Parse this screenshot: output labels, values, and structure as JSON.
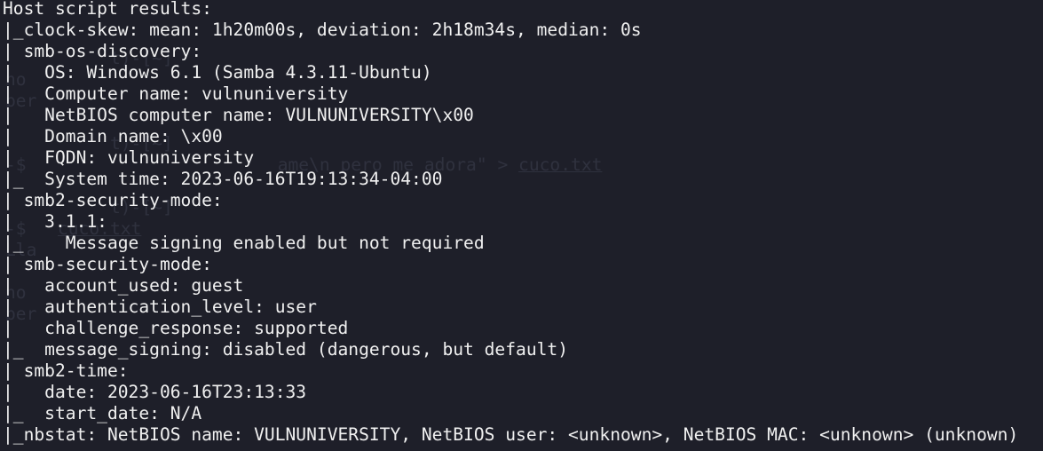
{
  "terminal": {
    "lines": [
      "Host script results:",
      "|_clock-skew: mean: 1h20m00s, deviation: 2h18m34s, median: 0s",
      "| smb-os-discovery: ",
      "|   OS: Windows 6.1 (Samba 4.3.11-Ubuntu)",
      "|   Computer name: vulnuniversity",
      "|   NetBIOS computer name: VULNUNIVERSITY\\x00",
      "|   Domain name: \\x00",
      "|   FQDN: vulnuniversity",
      "|_  System time: 2023-06-16T19:13:34-04:00",
      "| smb2-security-mode: ",
      "|   3.1.1: ",
      "|_    Message signing enabled but not required",
      "| smb-security-mode: ",
      "|   account_used: guest",
      "|   authentication_level: user",
      "|   challenge_response: supported",
      "|_  message_signing: disabled (dangerous, but default)",
      "| smb2-time: ",
      "|   date: 2023-06-16T23:13:33",
      "|_  start_date: N/A",
      "|_nbstat: NetBIOS name: VULNUNIVERSITY, NetBIOS user: <unknown>, NetBIOS MAC: <unknown> (unknown)"
    ]
  },
  "background_ghost": {
    "lines": [
      "",
      "",
      "",
      "no ",
      "per",
      "",
      "",
      "-$ ",
      "",
      "",
      "-$ ",
      "Lla",
      "",
      "no ",
      "per",
      "",
      ""
    ],
    "fragments": {
      "line2": "t)-[~]",
      "line6": "t)-[~]",
      "line7": "ame\\n pero me adora\" > ",
      "line7_file": "cuco.txt",
      "line9": "t)-[~]",
      "line10_file": "cuco.txt"
    }
  },
  "colors": {
    "background": "#1e1f29",
    "foreground": "#f0f0f0",
    "ghost": "#3e4150"
  }
}
